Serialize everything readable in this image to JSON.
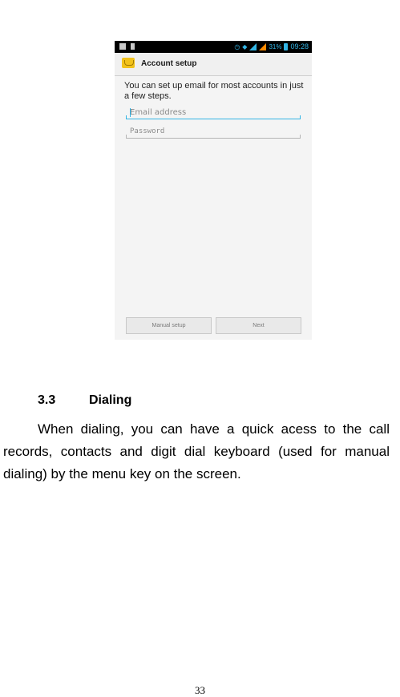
{
  "screenshot": {
    "status_bar": {
      "battery": "31%",
      "time": "09:28"
    },
    "action_bar": {
      "title": "Account setup"
    },
    "intro": "You can set up email for most accounts in just a few steps.",
    "email_field": {
      "placeholder": "Email address"
    },
    "password_field": {
      "placeholder": "Password"
    },
    "buttons": {
      "manual_setup": "Manual setup",
      "next": "Next"
    },
    "accent_color": "#33b5e5"
  },
  "section": {
    "number": "3.3",
    "title": "Dialing",
    "body": "When dialing, you can have a quick acess to the call records, contacts and digit dial keyboard (used for manual dialing) by the menu key on the screen."
  },
  "page_number": "33"
}
